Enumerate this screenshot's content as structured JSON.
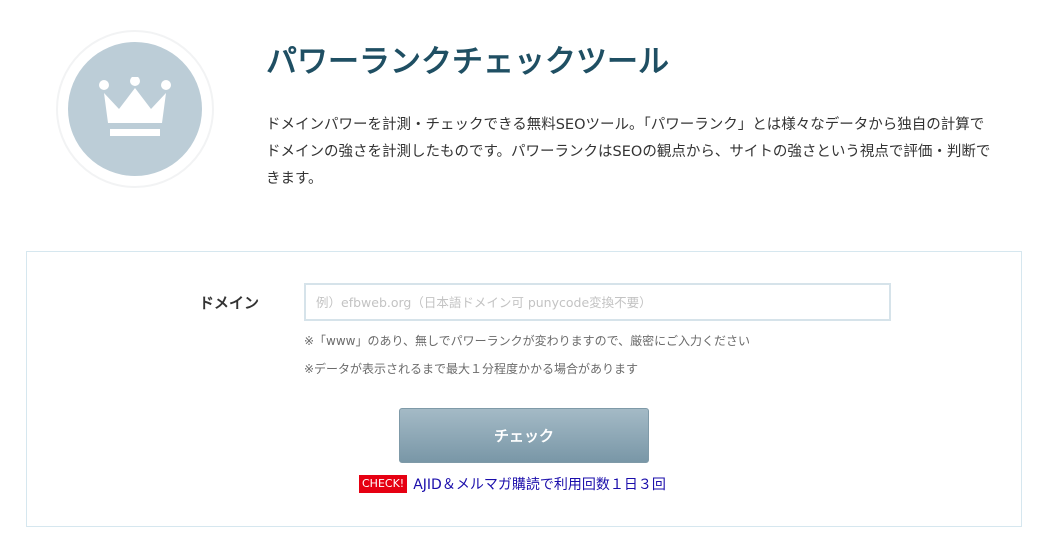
{
  "header": {
    "logo_icon": "crown-icon",
    "title": "パワーランクチェックツール",
    "description": "ドメインパワーを計測・チェックできる無料SEOツール。「パワーランク」とは様々なデータから独自の計算でドメインの強さを計測したものです。パワーランクはSEOの観点から、サイトの強さという視点で評価・判断できます。"
  },
  "form": {
    "domain_label": "ドメイン",
    "domain_placeholder": "例）efbweb.org（日本語ドメイン可 punycode変換不要）",
    "domain_value": "",
    "note_www": "※「www」のあり、無しでパワーランクが変わりますので、厳密にご入力ください",
    "note_time": "※データが表示されるまで最大１分程度かかる場合があります",
    "submit_label": "チェック"
  },
  "promo": {
    "badge": "CHECK!",
    "link_text": "AJID＆メルマガ購読で利用回数１日３回"
  },
  "colors": {
    "title": "#1f4f63",
    "logo_bg": "#bccdd7",
    "button": "#8aa5b3",
    "badge": "#e60012",
    "link": "#1a0dab"
  }
}
